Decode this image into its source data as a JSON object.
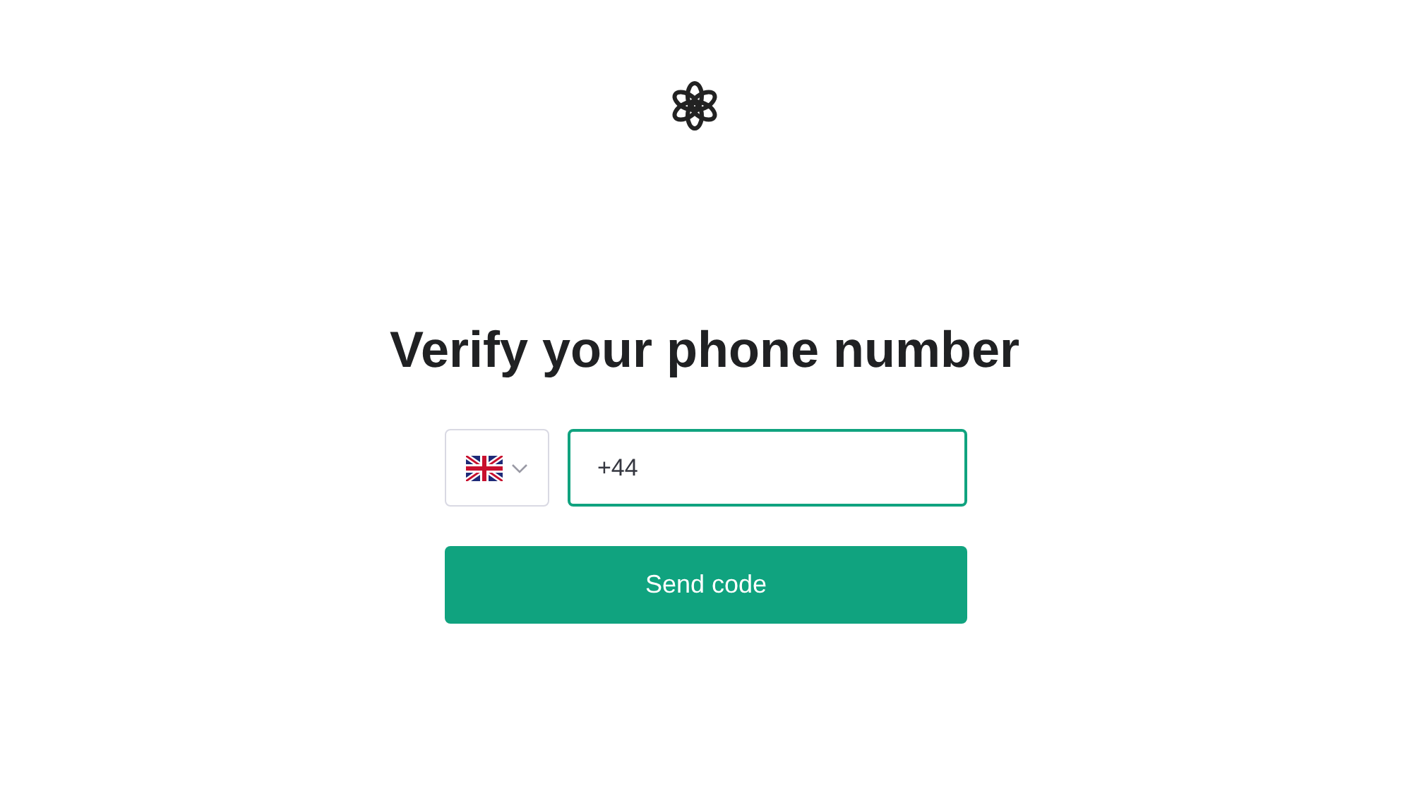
{
  "heading": "Verify your phone number",
  "country_select": {
    "expanded": false
  },
  "phone_field": {
    "value": "+44",
    "focused": true
  },
  "submit_button": {
    "label": "Send code"
  }
}
